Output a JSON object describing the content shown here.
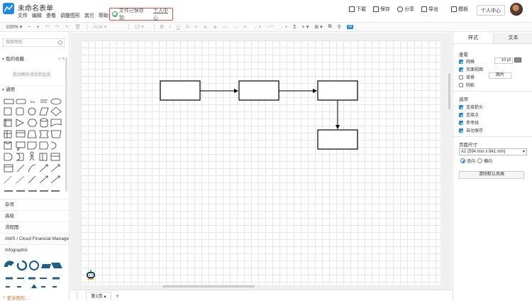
{
  "app": {
    "title": "未命名表单",
    "menu": [
      "文件",
      "编辑",
      "查看",
      "调整图形",
      "其它",
      "帮助"
    ],
    "save_status": "文件已保存到:",
    "save_location": "个人中心",
    "actions": [
      {
        "icon": "download-icon",
        "label": "下载"
      },
      {
        "icon": "save-icon",
        "label": "保存"
      },
      {
        "icon": "share-icon",
        "label": "分享"
      },
      {
        "icon": "export-icon",
        "label": "导出"
      },
      {
        "icon": "template-icon",
        "label": "模板"
      }
    ],
    "personal_center": "个人中心"
  },
  "toolbar": {
    "zoom": "100%",
    "font": "Arial",
    "font_size": "12",
    "sigma": "Σ",
    "ai": "AI"
  },
  "sidebar": {
    "search_placeholder": "搜索图形",
    "favorites": "我的收藏",
    "drag_hint": "拖动图形添加到此处",
    "general": "通用",
    "categories": [
      "杂项",
      "高级",
      "流程图",
      "AWS / Cloud Financial Manage",
      "Infographic"
    ],
    "more_shapes": "更多图形..."
  },
  "pages": {
    "tab": "第1页"
  },
  "right_panel": {
    "tabs": [
      "样式",
      "文本"
    ],
    "view_section": "查看",
    "view_options": [
      {
        "label": "网格",
        "checked": true
      },
      {
        "label": "页面视图",
        "checked": true
      },
      {
        "label": "背景",
        "checked": false
      },
      {
        "label": "阴影",
        "checked": false
      }
    ],
    "grid_size": "10 pt",
    "image_button": "图片",
    "options_section": "选项",
    "options": [
      {
        "label": "连接箭头",
        "checked": true
      },
      {
        "label": "连接点",
        "checked": true
      },
      {
        "label": "参考线",
        "checked": true
      },
      {
        "label": "自动保存",
        "checked": true
      }
    ],
    "paper_section": "页面尺寸",
    "paper_size": "A1 (594 mm x 841 mm)",
    "orientation_portrait": "竖向",
    "orientation_landscape": "横向",
    "reset_button": "清除默认风格"
  }
}
